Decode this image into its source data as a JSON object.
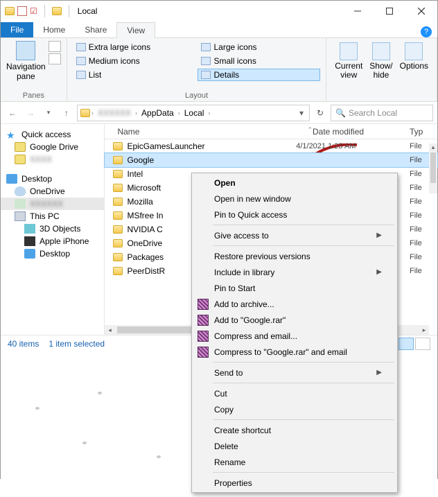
{
  "window": {
    "title": "Local"
  },
  "tabs": {
    "file": "File",
    "home": "Home",
    "share": "Share",
    "view": "View"
  },
  "ribbon": {
    "nav_pane": "Navigation\npane",
    "panes_label": "Panes",
    "layout": {
      "xl": "Extra large icons",
      "lg": "Large icons",
      "md": "Medium icons",
      "sm": "Small icons",
      "list": "List",
      "details": "Details"
    },
    "layout_label": "Layout",
    "current_view": "Current\nview",
    "show_hide": "Show/\nhide",
    "options": "Options"
  },
  "breadcrumb": {
    "appdata": "AppData",
    "local": "Local"
  },
  "search": {
    "placeholder": "Search Local"
  },
  "columns": {
    "name": "Name",
    "date": "Date modified",
    "type": "Typ"
  },
  "sidebar": {
    "quick": "Quick access",
    "gdrive": "Google Drive",
    "desktop": "Desktop",
    "onedrive": "OneDrive",
    "thispc": "This PC",
    "obj3d": "3D Objects",
    "iphone": "Apple iPhone",
    "desktop2": "Desktop"
  },
  "rows": [
    {
      "name": "EpicGamesLauncher",
      "date": "4/1/2021 1:23 AM",
      "type": "File"
    },
    {
      "name": "Google",
      "date": "",
      "type": "File"
    },
    {
      "name": "Intel",
      "date": "",
      "type": "File"
    },
    {
      "name": "Microsoft",
      "date": "",
      "type": "File"
    },
    {
      "name": "Mozilla",
      "date": "",
      "type": "File"
    },
    {
      "name": "MSfree In",
      "date": "",
      "type": "File"
    },
    {
      "name": "NVIDIA C",
      "date": "",
      "type": "File"
    },
    {
      "name": "OneDrive",
      "date": "",
      "type": "File"
    },
    {
      "name": "Packages",
      "date": "",
      "type": "File"
    },
    {
      "name": "PeerDistR",
      "date": "",
      "type": "File"
    }
  ],
  "status": {
    "count": "40 items",
    "selected": "1 item selected"
  },
  "ctx": {
    "open": "Open",
    "open_new": "Open in new window",
    "pin_quick": "Pin to Quick access",
    "give_access": "Give access to",
    "restore": "Restore previous versions",
    "include_lib": "Include in library",
    "pin_start": "Pin to Start",
    "add_archive": "Add to archive...",
    "add_rar": "Add to \"Google.rar\"",
    "compress_email": "Compress and email...",
    "compress_rar_email": "Compress to \"Google.rar\" and email",
    "send_to": "Send to",
    "cut": "Cut",
    "copy": "Copy",
    "shortcut": "Create shortcut",
    "delete": "Delete",
    "rename": "Rename",
    "properties": "Properties"
  }
}
